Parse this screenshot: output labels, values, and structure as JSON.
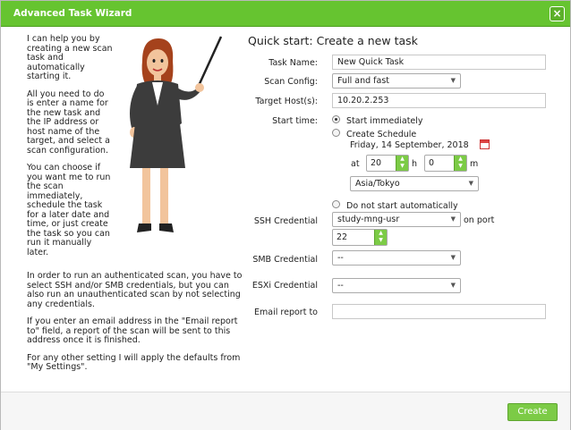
{
  "window": {
    "title": "Advanced Task Wizard",
    "close_icon": "close-icon"
  },
  "intro": {
    "p1": "I can help you by creating a new scan task and automatically starting it.",
    "p2": "All you need to do is enter a name for the new task and the IP address or host name of the target, and select a scan configuration.",
    "p3": "You can choose if you want me to run the scan immediately, schedule the task for a later date and time, or just create the task so you can run it manually later.",
    "p4": "In order to run an authenticated scan, you have to select SSH and/or SMB credentials, but you can also run an unauthenticated scan by not selecting any credentials.",
    "p5": "If you enter an email address in the \"Email report to\" field, a report of the scan will be sent to this address once it is finished.",
    "p6": "For any other setting I will apply the defaults from \"My Settings\"."
  },
  "form": {
    "heading": "Quick start: Create a new task",
    "task_name_label": "Task Name:",
    "task_name_value": "New Quick Task",
    "scan_config_label": "Scan Config:",
    "scan_config_value": "Full and fast",
    "target_label": "Target Host(s):",
    "target_value": "10.20.2.253",
    "start_time_label": "Start time:",
    "opt_immediately": "Start immediately",
    "opt_schedule": "Create Schedule",
    "schedule_date": "Friday, 14 September, 2018",
    "at_label": "at",
    "hour_value": "20",
    "h_label": "h",
    "minute_value": "0",
    "m_label": "m",
    "timezone_value": "Asia/Tokyo",
    "opt_no_start": "Do not start automatically",
    "ssh_label": "SSH Credential",
    "ssh_value": "study-mng-usr",
    "on_port_label": "on port",
    "port_value": "22",
    "smb_label": "SMB Credential",
    "smb_value": "--",
    "esxi_label": "ESXi Credential",
    "esxi_value": "--",
    "email_label": "Email report to",
    "email_value": ""
  },
  "footer": {
    "create_label": "Create"
  },
  "colors": {
    "accent": "#66c430",
    "button": "#7ccb46"
  }
}
